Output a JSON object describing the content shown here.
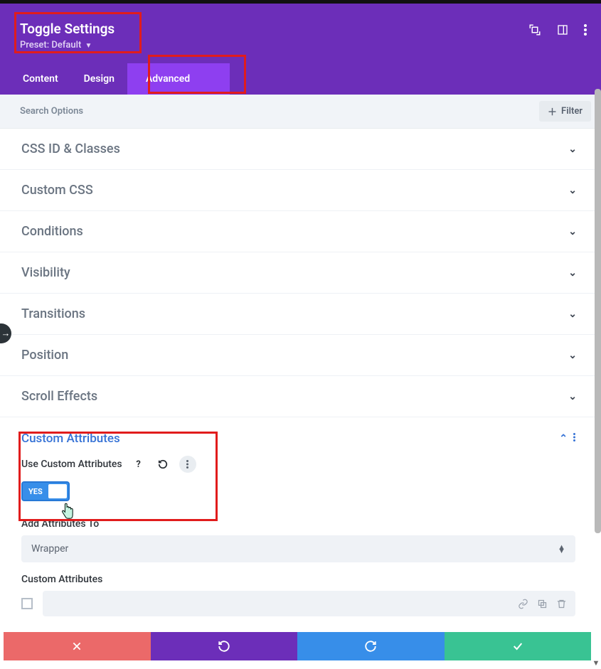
{
  "header": {
    "title": "Toggle Settings",
    "preset_label": "Preset: Default"
  },
  "tabs": {
    "content": "Content",
    "design": "Design",
    "advanced": "Advanced"
  },
  "filter": {
    "search_placeholder": "Search Options",
    "filter_btn": "Filter"
  },
  "sections": {
    "css_id": "CSS ID & Classes",
    "custom_css": "Custom CSS",
    "conditions": "Conditions",
    "visibility": "Visibility",
    "transitions": "Transitions",
    "position": "Position",
    "scroll_effects": "Scroll Effects",
    "custom_attributes": "Custom Attributes"
  },
  "custom_attr": {
    "use_label": "Use Custom Attributes",
    "toggle_text": "YES",
    "add_to_label": "Add Attributes To",
    "add_to_value": "Wrapper",
    "list_label": "Custom Attributes"
  }
}
